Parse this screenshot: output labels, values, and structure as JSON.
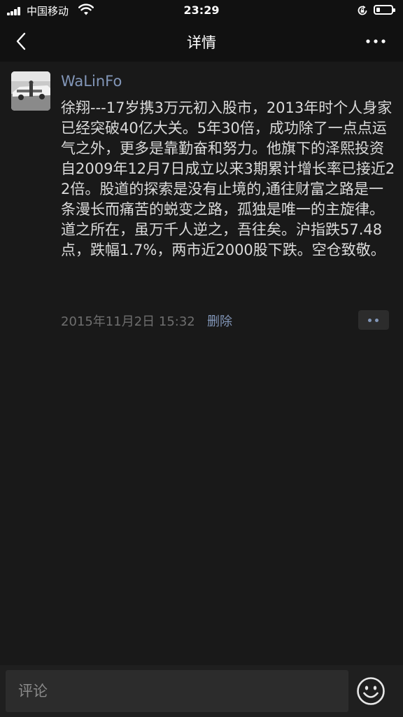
{
  "status_bar": {
    "carrier": "中国移动",
    "time": "23:29",
    "signal_icon": "signal-bars-icon",
    "wifi_icon": "wifi-icon",
    "rotation_icon": "rotation-lock-icon",
    "battery_icon": "battery-icon",
    "battery_level": 0.2
  },
  "nav": {
    "title": "详情",
    "back_icon": "chevron-left-icon",
    "more_icon": "more-horizontal-icon"
  },
  "post": {
    "username": "WaLinFo",
    "text": "徐翔---17岁携3万元初入股市，2013年时个人身家已经突破40亿大关。5年30倍，成功除了一点点运气之外，更多是靠勤奋和努力。他旗下的泽熙投资自2009年12月7日成立以来3期累计增长率已接近22倍。股道的探索是没有止境的,通往财富之路是一条漫长而痛苦的蜕变之路，孤独是唯一的主旋律。道之所在，虽万千人逆之，吾往矣。沪指跌57.48点，跌幅1.7%，两市近2000股下跌。空仓致敬。",
    "timestamp": "2015年11月2日 15:32",
    "delete_label": "删除",
    "action_icon": "two-dots-icon"
  },
  "comment_bar": {
    "placeholder": "评论",
    "emoji_icon": "smiley-face-icon"
  },
  "colors": {
    "background": "#191919",
    "bar_background": "#111111",
    "link_blue": "#8296b8",
    "text": "#dadada",
    "meta_gray": "#6e6e6e"
  }
}
